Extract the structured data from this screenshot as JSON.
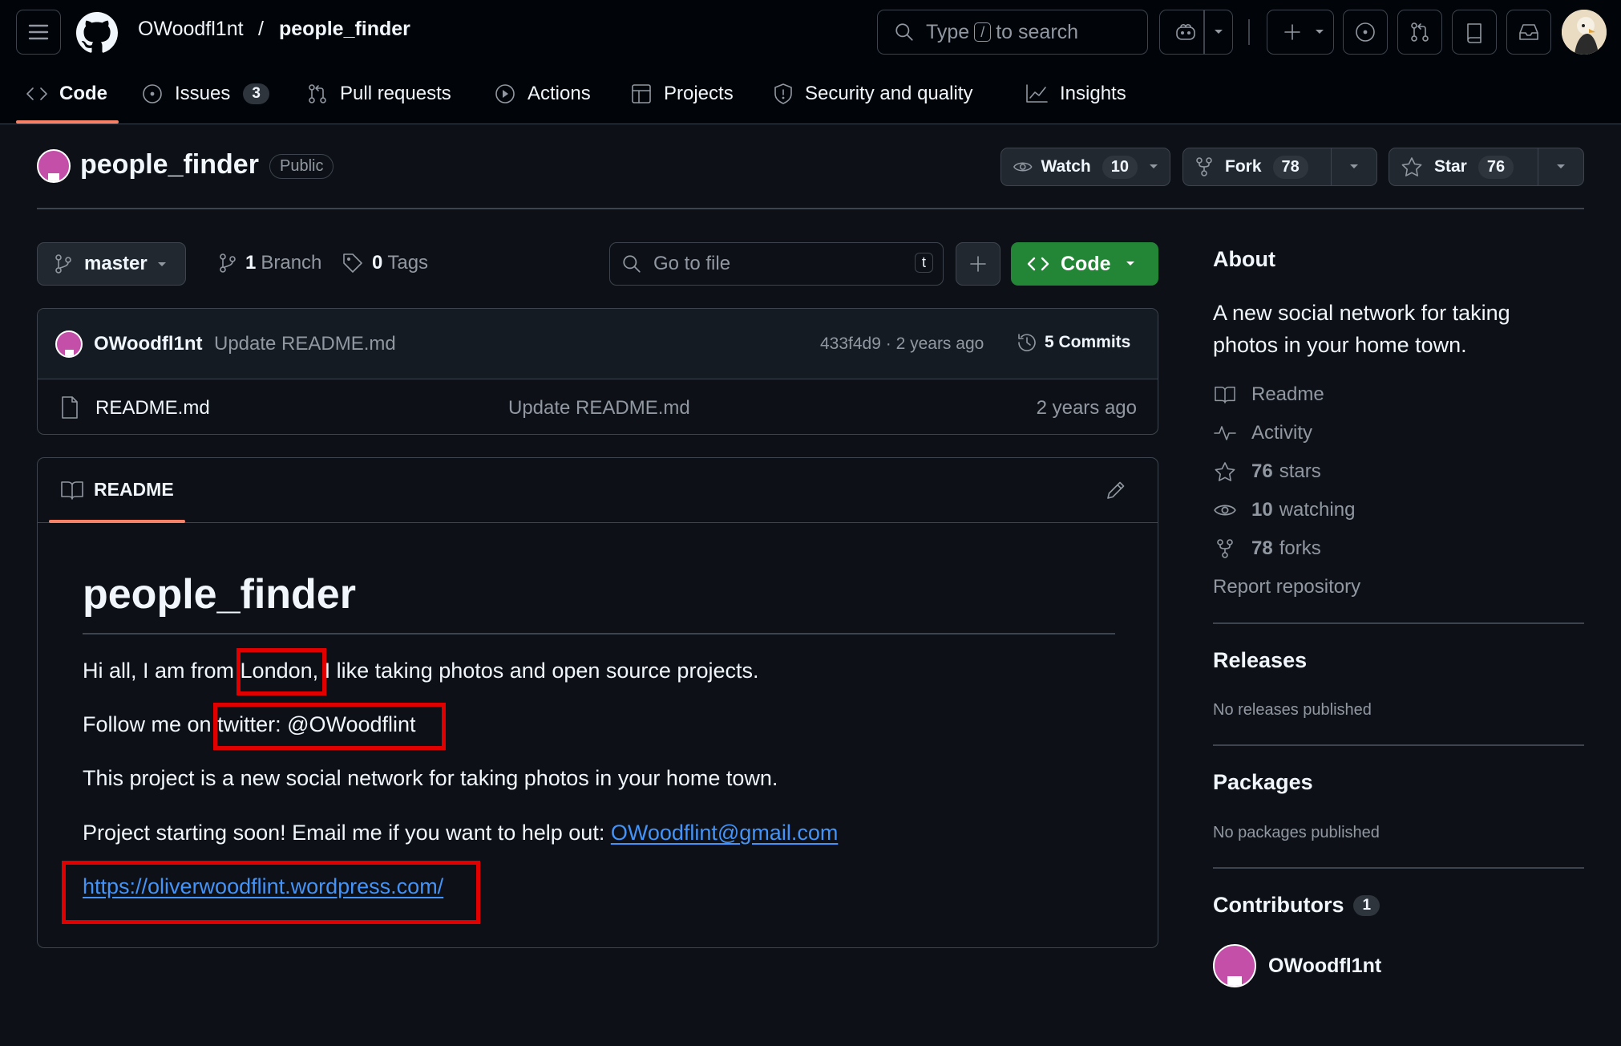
{
  "header": {
    "owner": "OWoodfl1nt",
    "separator": "/",
    "repo": "people_finder",
    "search": {
      "prefix": "Type",
      "key": "/",
      "suffix": "to search"
    }
  },
  "tabs": [
    {
      "label": "Code",
      "icon": "code-icon"
    },
    {
      "label": "Issues",
      "icon": "issue-icon",
      "count": "3"
    },
    {
      "label": "Pull requests",
      "icon": "pull-request-icon"
    },
    {
      "label": "Actions",
      "icon": "play-icon"
    },
    {
      "label": "Projects",
      "icon": "table-icon"
    },
    {
      "label": "Security and quality",
      "icon": "shield-icon"
    },
    {
      "label": "Insights",
      "icon": "graph-icon"
    }
  ],
  "repo": {
    "name": "people_finder",
    "visibility": "Public",
    "watch": {
      "label": "Watch",
      "count": "10"
    },
    "fork": {
      "label": "Fork",
      "count": "78"
    },
    "star": {
      "label": "Star",
      "count": "76"
    }
  },
  "toolbar": {
    "branch": "master",
    "branches_count": "1",
    "branches_label": "Branch",
    "tags_count": "0",
    "tags_label": "Tags",
    "goto_placeholder": "Go to file",
    "goto_key": "t",
    "code_label": "Code"
  },
  "latest_commit": {
    "author": "OWoodfl1nt",
    "message": "Update README.md",
    "hash_time": "433f4d9 · 2 years ago",
    "commits_label": "5 Commits"
  },
  "files": [
    {
      "name": "README.md",
      "message": "Update README.md",
      "time": "2 years ago"
    }
  ],
  "readme": {
    "tab_label": "README",
    "title": "people_finder",
    "line1": {
      "before": "Hi all, I am from ",
      "city": "London",
      "after": ", I like taking photos and open source projects."
    },
    "line2": {
      "before": "Follow me on ",
      "handle": "twitter: @OWoodflint"
    },
    "line3": "This project is a new social network for taking photos in your home town.",
    "line4": {
      "before": "Project starting soon! Email me if you want to help out: ",
      "email": "OWoodflint@gmail.com"
    },
    "line5": "https://oliverwoodflint.wordpress.com/"
  },
  "sidebar": {
    "about_heading": "About",
    "description": "A new social network for taking photos in your home town.",
    "items": [
      {
        "icon": "book-icon",
        "count": "",
        "label": "Readme"
      },
      {
        "icon": "pulse-icon",
        "count": "",
        "label": "Activity"
      },
      {
        "icon": "star-icon",
        "count": "76",
        "label": "stars"
      },
      {
        "icon": "eye-icon",
        "count": "10",
        "label": "watching"
      },
      {
        "icon": "fork-icon",
        "count": "78",
        "label": "forks"
      }
    ],
    "report": "Report repository",
    "releases_heading": "Releases",
    "releases_text": "No releases published",
    "packages_heading": "Packages",
    "packages_text": "No packages published",
    "contributors_heading": "Contributors",
    "contributors_count": "1",
    "contributor_name": "OWoodfl1nt"
  },
  "colors": {
    "background": "#0d1117",
    "accent_tab": "#f78166",
    "code_button": "#238636",
    "link": "#4493f8",
    "highlight_box": "#e10000",
    "avatar": "#c44fa8"
  }
}
